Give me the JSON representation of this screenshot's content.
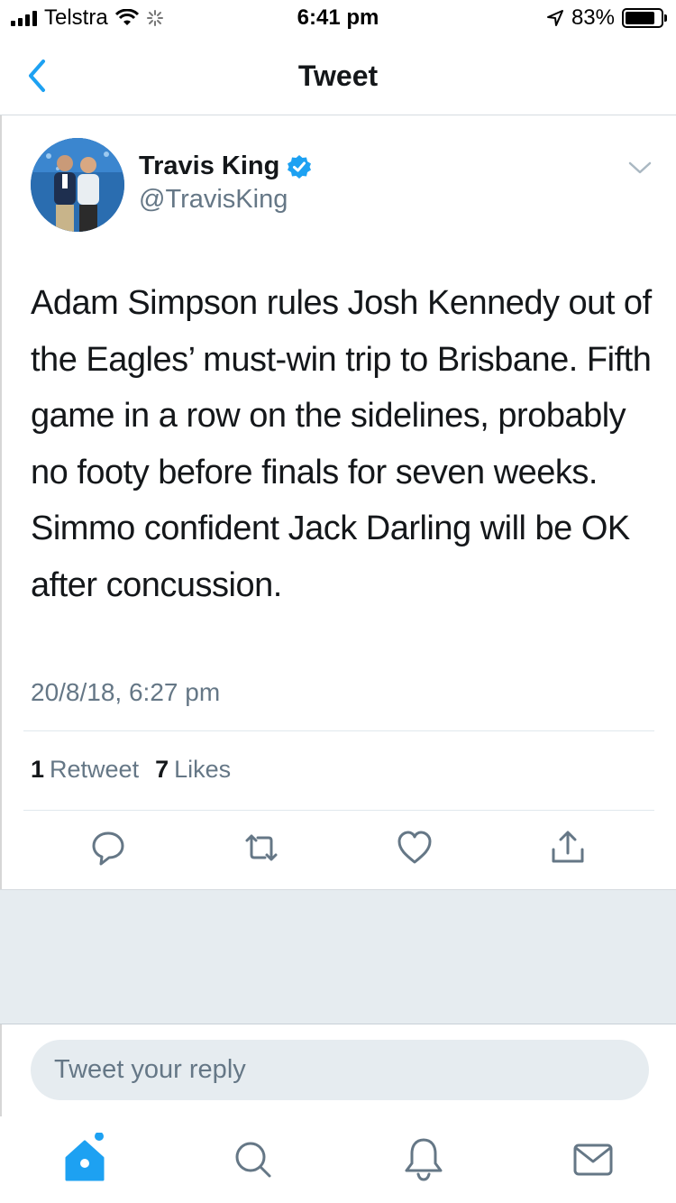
{
  "status_bar": {
    "carrier": "Telstra",
    "time": "6:41 pm",
    "battery_percent": "83%",
    "battery_level": 0.83
  },
  "nav": {
    "title": "Tweet"
  },
  "tweet": {
    "author_name": "Travis King",
    "handle": "@TravisKing",
    "verified": true,
    "text": "Adam Simpson rules Josh Kennedy out of the Eagles’ must-win trip to Brisbane. Fifth game in a row on the sidelines, probably no footy before finals for seven weeks. Simmo confident Jack Darling will be OK after concussion.",
    "timestamp": "20/8/18, 6:27 pm",
    "retweet_count": "1",
    "retweet_label": "Retweet",
    "like_count": "7",
    "like_label": "Likes"
  },
  "reply": {
    "placeholder": "Tweet your reply"
  },
  "icons": {
    "back": "chevron-left-icon",
    "caret": "chevron-down-icon",
    "reply": "comment-icon",
    "retweet": "retweet-icon",
    "like": "heart-icon",
    "share": "share-icon",
    "home": "home-icon",
    "search": "search-icon",
    "notifications": "bell-icon",
    "messages": "envelope-icon"
  },
  "colors": {
    "accent": "#1da1f2",
    "text_secondary": "#657786",
    "icon_gray": "#657786"
  }
}
